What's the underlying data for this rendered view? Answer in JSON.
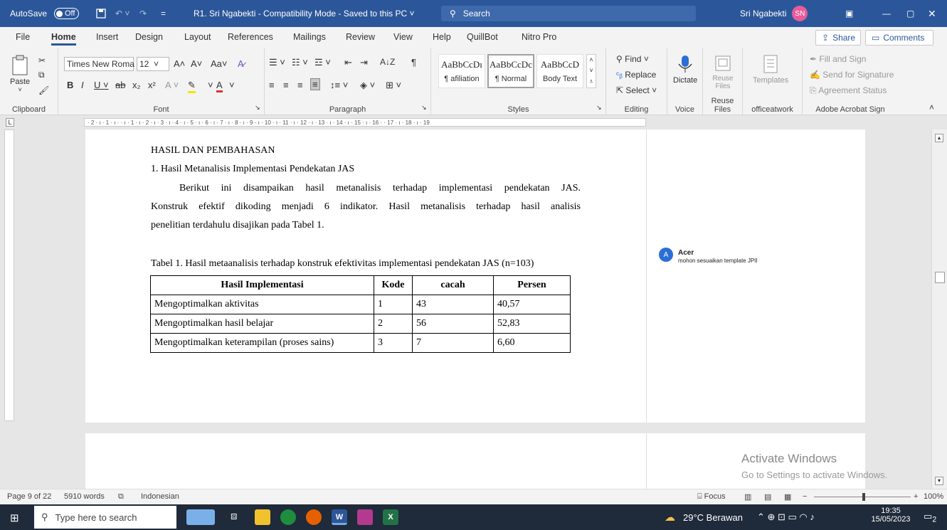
{
  "titlebar": {
    "autosave_label": "AutoSave",
    "autosave_state": "Off",
    "doc_title": "R1. Sri Ngabekti  -  Compatibility Mode  -  Saved to this PC",
    "search_placeholder": "Search",
    "user_name": "Sri Ngabekti",
    "user_initials": "SN"
  },
  "menu": {
    "tabs": [
      "File",
      "Home",
      "Insert",
      "Design",
      "Layout",
      "References",
      "Mailings",
      "Review",
      "View",
      "Help",
      "QuillBot",
      "Nitro Pro"
    ],
    "active": "Home",
    "share_label": "Share",
    "comments_label": "Comments"
  },
  "ribbon": {
    "clipboard": {
      "paste": "Paste",
      "label": "Clipboard"
    },
    "font": {
      "name": "Times New Roma",
      "size": "12",
      "label": "Font"
    },
    "paragraph": {
      "label": "Paragraph"
    },
    "styles": {
      "items": [
        {
          "preview": "AaBbCcDı",
          "name": "¶ afiliation"
        },
        {
          "preview": "AaBbCcDc",
          "name": "¶ Normal"
        },
        {
          "preview": "AaBbCcD",
          "name": "Body Text"
        }
      ],
      "label": "Styles"
    },
    "editing": {
      "find": "Find",
      "replace": "Replace",
      "select": "Select",
      "label": "Editing"
    },
    "voice": {
      "dictate": "Dictate",
      "label": "Voice"
    },
    "reuse": {
      "reuse": "Reuse Files",
      "label": "Reuse Files"
    },
    "officeatwork": {
      "templates": "Templates",
      "label": "officeatwork"
    },
    "acrobat": {
      "fill": "Fill and Sign",
      "send": "Send for Signature",
      "agreement": "Agreement Status",
      "label": "Adobe Acrobat Sign"
    }
  },
  "ruler": {
    "text": "· 2 · ı · 1 · ı ·   · ı · 1 · ı · 2 · ı · 3 · ı · 4 · ı · 5 · ı · 6 · ı · 7 · ı · 8 · ı · 9 · ı · 10 · ı · 11 · ı · 12 · ı · 13 · ı · 14 · ı · 15 · ı · 16 ·   · 17 · ı · 18 · ı · 19"
  },
  "document": {
    "heading": "HASIL DAN PEMBAHASAN",
    "subheading": "1.   Hasil Metanalisis Implementasi Pendekatan JAS",
    "paragraph_line1": "Berikut ini disampaikan hasil metanalisis terhadap implementasi pendekatan JAS.",
    "paragraph_line2": "Konstruk efektif dikoding menjadi 6 indikator. Hasil metanalisis terhadap hasil analisis",
    "paragraph_line3": "penelitian terdahulu disajikan pada Tabel 1.",
    "table_caption": "Tabel 1. Hasil metaanalisis terhadap konstruk efektivitas implementasi pendekatan JAS (n=103)",
    "table": {
      "headers": [
        "Hasil Implementasi",
        "Kode",
        "cacah",
        "Persen"
      ],
      "rows": [
        [
          "Mengoptimalkan aktivitas",
          "1",
          "43",
          "40,57"
        ],
        [
          "Mengoptimalkan hasil belajar",
          "2",
          "56",
          "52,83"
        ],
        [
          "Mengoptimalkan keterampilan (proses sains)",
          "3",
          "7",
          "6,60"
        ]
      ]
    }
  },
  "comment": {
    "initial": "A",
    "author": "Acer",
    "text": "mohon sesuaikan template JPII"
  },
  "watermark": {
    "line1": "Activate Windows",
    "line2": "Go to Settings to activate Windows."
  },
  "status": {
    "page": "Page 9 of 22",
    "words": "5910 words",
    "language": "Indonesian",
    "focus": "Focus",
    "zoom": "100%"
  },
  "taskbar": {
    "search_placeholder": "Type here to search",
    "weather": "29°C  Berawan",
    "time": "19:35",
    "date": "15/05/2023",
    "notif_count": "2"
  }
}
